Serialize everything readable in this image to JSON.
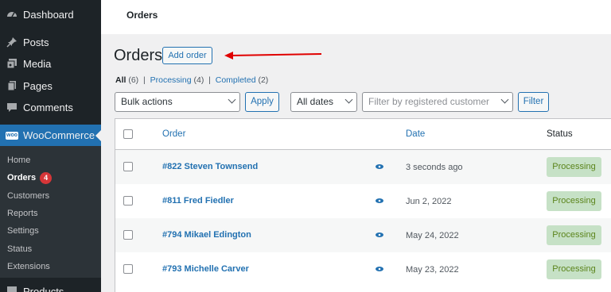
{
  "sidebar": {
    "items": [
      {
        "label": "Dashboard",
        "icon": "dashboard-icon"
      },
      {
        "label": "Posts",
        "icon": "pin-icon"
      },
      {
        "label": "Media",
        "icon": "media-icon"
      },
      {
        "label": "Pages",
        "icon": "pages-icon"
      },
      {
        "label": "Comments",
        "icon": "comments-icon"
      }
    ],
    "woocommerce": {
      "label": "WooCommerce",
      "badge": "woo"
    },
    "submenu": [
      {
        "label": "Home"
      },
      {
        "label": "Orders",
        "count": "4"
      },
      {
        "label": "Customers"
      },
      {
        "label": "Reports"
      },
      {
        "label": "Settings"
      },
      {
        "label": "Status"
      },
      {
        "label": "Extensions"
      }
    ],
    "products": {
      "label": "Products"
    }
  },
  "topbar": {
    "title": "Orders"
  },
  "page": {
    "title": "Orders",
    "add_button": "Add order"
  },
  "filters": {
    "all": {
      "label": "All",
      "count": "(6)"
    },
    "processing": {
      "label": "Processing",
      "count": "(4)"
    },
    "completed": {
      "label": "Completed",
      "count": "(2)"
    },
    "separator": "|",
    "bulk_actions": "Bulk actions",
    "apply": "Apply",
    "dates": "All dates",
    "customer_placeholder": "Filter by registered customer",
    "filter": "Filter"
  },
  "table": {
    "headers": {
      "order": "Order",
      "date": "Date",
      "status": "Status"
    },
    "rows": [
      {
        "order": "#822 Steven Townsend",
        "date": "3 seconds ago",
        "status": "Processing"
      },
      {
        "order": "#811 Fred Fiedler",
        "date": "Jun 2, 2022",
        "status": "Processing"
      },
      {
        "order": "#794 Mikael Edington",
        "date": "May 24, 2022",
        "status": "Processing"
      },
      {
        "order": "#793 Michelle Carver",
        "date": "May 23, 2022",
        "status": "Processing"
      }
    ]
  },
  "colors": {
    "accent": "#2271b1",
    "sidebar": "#1d2327",
    "processing_bg": "#c6e1c6",
    "processing_text": "#5b841b",
    "arrow": "#e00000"
  }
}
